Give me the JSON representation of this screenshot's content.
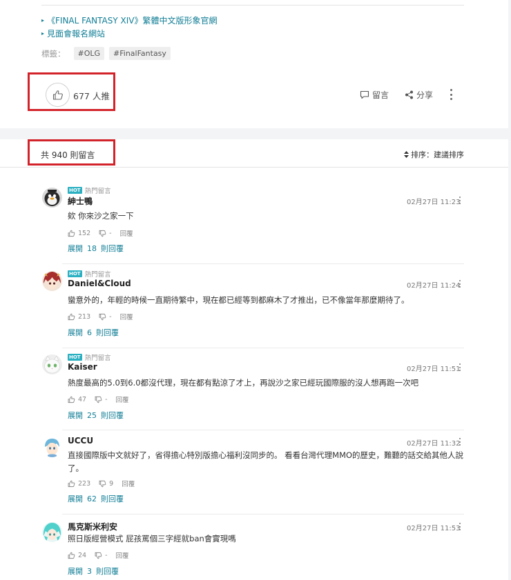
{
  "article": {
    "links": [
      "《FINAL FANTASY XIV》繁體中文版形象官網",
      "見面會報名網站"
    ],
    "tags_label": "標籤：",
    "tags": [
      "#OLG",
      "#FinalFantasy"
    ],
    "like_count": "677 人推",
    "comment_label": "留言",
    "share_label": "分享"
  },
  "comments_section": {
    "count": "共 940 則留言",
    "sort_label": "排序：建議排序"
  },
  "comments": [
    {
      "hot_badge": "HOT",
      "hot_label": "熱門留言",
      "username": "紳士鴨",
      "time": "02月27日 11:23",
      "text": "欸 你來沙之家一下",
      "likes": "152",
      "dislikes": "-",
      "reply": "回覆",
      "expand_label": "展開",
      "expand_count": "18",
      "expand_suffix": "則回覆"
    },
    {
      "hot_badge": "HOT",
      "hot_label": "熱門留言",
      "username": "Daniel&Cloud",
      "time": "02月27日 11:24",
      "text": "蠻意外的，年輕的時候一直期待繁中，現在都已經等到都麻木了才推出，已不像當年那麼期待了。",
      "likes": "213",
      "dislikes": "-",
      "reply": "回覆",
      "expand_label": "展開",
      "expand_count": "6",
      "expand_suffix": "則回覆"
    },
    {
      "hot_badge": "HOT",
      "hot_label": "熱門留言",
      "username": "Kaiser",
      "time": "02月27日 11:51",
      "text": "熱度最高的5.0到6.0都沒代理，現在都有點涼了才上，再說沙之家已經玩國際服的沒人想再跑一次吧",
      "likes": "47",
      "dislikes": "-",
      "reply": "回覆",
      "expand_label": "展開",
      "expand_count": "25",
      "expand_suffix": "則回覆"
    },
    {
      "username": "UCCU",
      "time": "02月27日 11:32",
      "text": "直接國際版中文就好了，省得擔心特別版擔心福利沒同步的。 看看台灣代理MMO的歷史，難聽的話交給其他人說了。",
      "likes": "223",
      "dislikes": "9",
      "reply": "回覆",
      "expand_label": "展開",
      "expand_count": "62",
      "expand_suffix": "則回覆"
    },
    {
      "username": "馬克斯米利安",
      "time": "02月27日 11:53",
      "text": "照日版經營模式 屁孩罵個三字經就ban會實現嗎",
      "likes": "24",
      "dislikes": "-",
      "reply": "回覆",
      "expand_label": "展開",
      "expand_count": "3",
      "expand_suffix": "則回覆"
    }
  ],
  "colors": {
    "link": "#117e96",
    "hot_badge": "#2bb0c2",
    "highlight": "#d3232a",
    "background": "#f3f4f5"
  }
}
